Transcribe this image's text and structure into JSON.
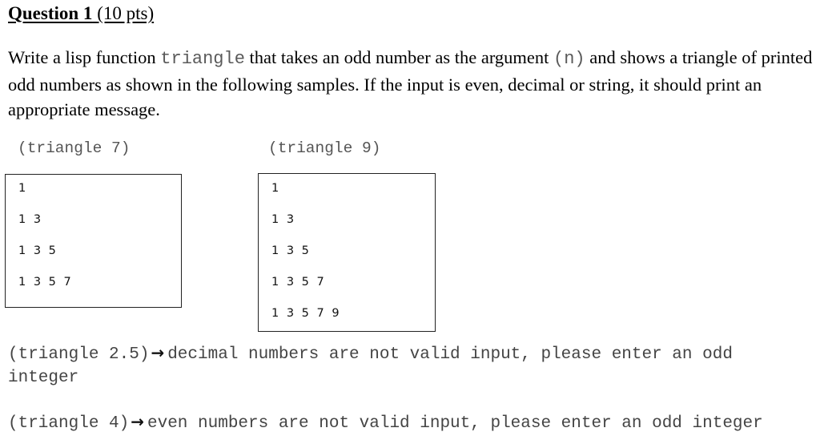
{
  "question": {
    "title_bold": "Question 1",
    "title_points": "(10 pts)"
  },
  "prompt": {
    "part1": "Write a lisp function ",
    "function_name": "triangle",
    "part2": " that takes an odd number as the argument ",
    "argument": "(n)",
    "part3": " and shows a triangle of printed odd numbers as shown in the following samples. If the input is even, decimal or string, it should print an appropriate message."
  },
  "samples": [
    {
      "call": "(triangle 7)",
      "rows": [
        "1",
        "1 3",
        "1 3 5",
        "1 3 5 7"
      ]
    },
    {
      "call": "(triangle 9)",
      "rows": [
        "1",
        "1 3",
        "1 3 5",
        "1 3 5 7",
        "1 3 5 7 9"
      ]
    }
  ],
  "error_examples": [
    {
      "call": "(triangle 2.5)",
      "arrow_icon": "→",
      "message_line1": "decimal numbers are not valid input, please enter an odd",
      "message_line2": "integer"
    },
    {
      "call": "(triangle 4)",
      "arrow_icon": "→",
      "message_line1": "even numbers are not valid input, please enter an odd integer"
    }
  ]
}
